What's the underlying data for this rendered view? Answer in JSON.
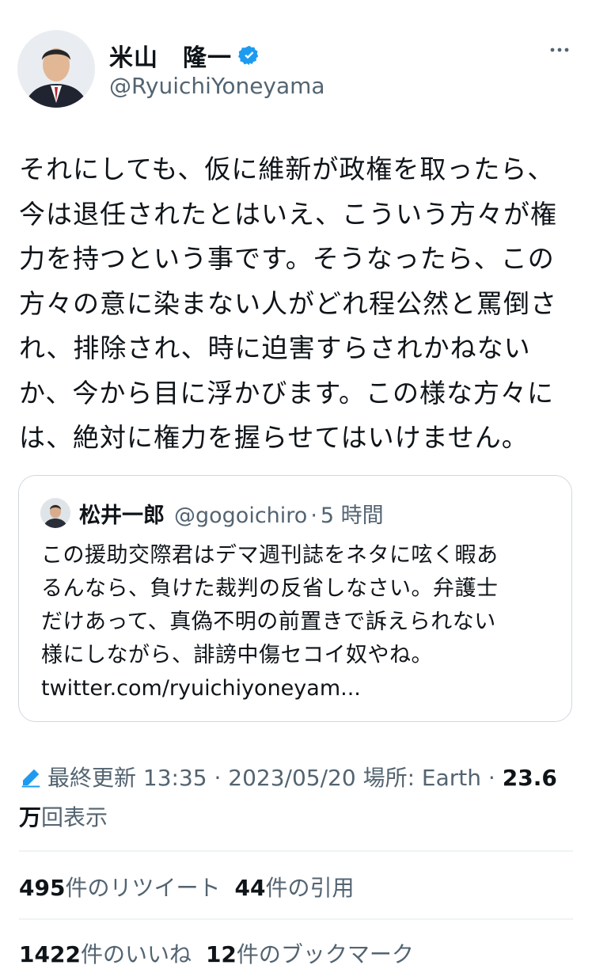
{
  "author": {
    "name": "米山　隆一",
    "handle": "@RyuichiYoneyama"
  },
  "tweet_text": "それにしても、仮に維新が政権を取ったら、\n今は退任されたとはいえ、こういう方々が権\n力を持つという事です。そうなったら、この\n方々の意に染まない人がどれ程公然と罵倒さ\nれ、排除され、時に迫害すらされかねない\nか、今から目に浮かびます。この様な方々に\nは、絶対に権力を握らせてはいけません。",
  "quote": {
    "name": "松井一郎",
    "handle": "@gogoichiro",
    "separator": "·",
    "time": "5 時間",
    "text": "この援助交際君はデマ週刊誌をネタに呟く暇あ\nるんなら、負けた裁判の反省しなさい。弁護士\nだけあって、真偽不明の前置きで訴えられない\n様にしながら、誹謗中傷セコイ奴やね。",
    "link": "twitter.com/ryuichiyoneyam..."
  },
  "meta": {
    "updated_label": "最終更新 13:35 · 2023/05/20",
    "location": "場所: Earth ·",
    "views_num_1": "23.6",
    "views_num_2": "万",
    "views_label": "回表示"
  },
  "stats": {
    "retweets_count": "495",
    "retweets_label": "件のリツイート",
    "quotes_count": "44",
    "quotes_label": "件の引用",
    "likes_count": "1422",
    "likes_label": "件のいいね",
    "bookmarks_count": "12",
    "bookmarks_label": "件のブックマーク"
  },
  "colors": {
    "verified": "#1d9bf0",
    "secondary_text": "#536471",
    "border": "#cfd9de"
  },
  "icons": [
    "verified-badge-icon",
    "more-icon",
    "edit-pencil-icon"
  ]
}
